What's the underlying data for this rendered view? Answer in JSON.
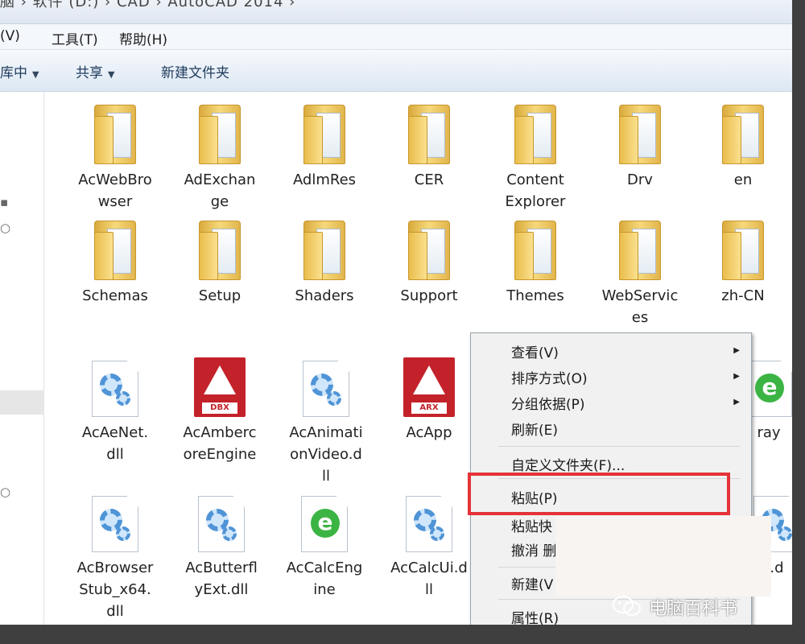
{
  "address": {
    "text": "脑 › 软件 (D:) › CAD › AutoCAD 2014 ›"
  },
  "menubar": {
    "view": "(V)",
    "tools": "工具(T)",
    "help": "帮助(H)"
  },
  "toolbar": {
    "include": "库中",
    "share": "共享",
    "new_folder": "新建文件夹"
  },
  "folders": [
    {
      "label": "AcWebBro\nwser"
    },
    {
      "label": "AdExchan\nge"
    },
    {
      "label": "AdlmRes"
    },
    {
      "label": "CER"
    },
    {
      "label": "Content\nExplorer"
    },
    {
      "label": "Drv"
    },
    {
      "label": "en"
    },
    {
      "label": "Schemas"
    },
    {
      "label": "Setup"
    },
    {
      "label": "Shaders"
    },
    {
      "label": "Support"
    },
    {
      "label": "Themes"
    },
    {
      "label": "WebServic\nes"
    },
    {
      "label": "zh-CN"
    }
  ],
  "files": [
    {
      "label": "AcAeNet.\ndll",
      "icon": "dll-gear-icon"
    },
    {
      "label": "AcAmberc\noreEngine",
      "icon": "autocad-dbx-icon",
      "tag": "DBX"
    },
    {
      "label": "AcAnimati\nonVideo.d\nll",
      "icon": "dll-gear-icon"
    },
    {
      "label": "AcApp",
      "icon": "autocad-arx-icon",
      "tag": "ARX"
    },
    {
      "label": "ray",
      "icon": "ie-file-icon"
    },
    {
      "label": "AcBrowser\nStub_x64.\ndll",
      "icon": "dll-gear-icon"
    },
    {
      "label": "AcButterfl\nyExt.dll",
      "icon": "dll-gear-icon"
    },
    {
      "label": "AcCalcEng\nine",
      "icon": "ie-file-icon"
    },
    {
      "label": "AcCalcUi.d\nll",
      "icon": "dll-gear-icon"
    },
    {
      "label": ".d",
      "icon": "dll-gear-icon"
    }
  ],
  "context_menu": {
    "view": "查看(V)",
    "sort": "排序方式(O)",
    "group": "分组依据(P)",
    "refresh": "刷新(E)",
    "customize": "自定义文件夹(F)...",
    "paste": "粘贴(P)",
    "paste_shortcut": "粘贴快",
    "undo": "撤消 删",
    "new": "新建(V",
    "properties": "属性(R)"
  },
  "watermark": {
    "text": "电脑百科书"
  },
  "colors": {
    "highlight_border": "#e53238",
    "context_bg": "#f1f1f1",
    "toolbar_text": "#1e3b5c"
  }
}
